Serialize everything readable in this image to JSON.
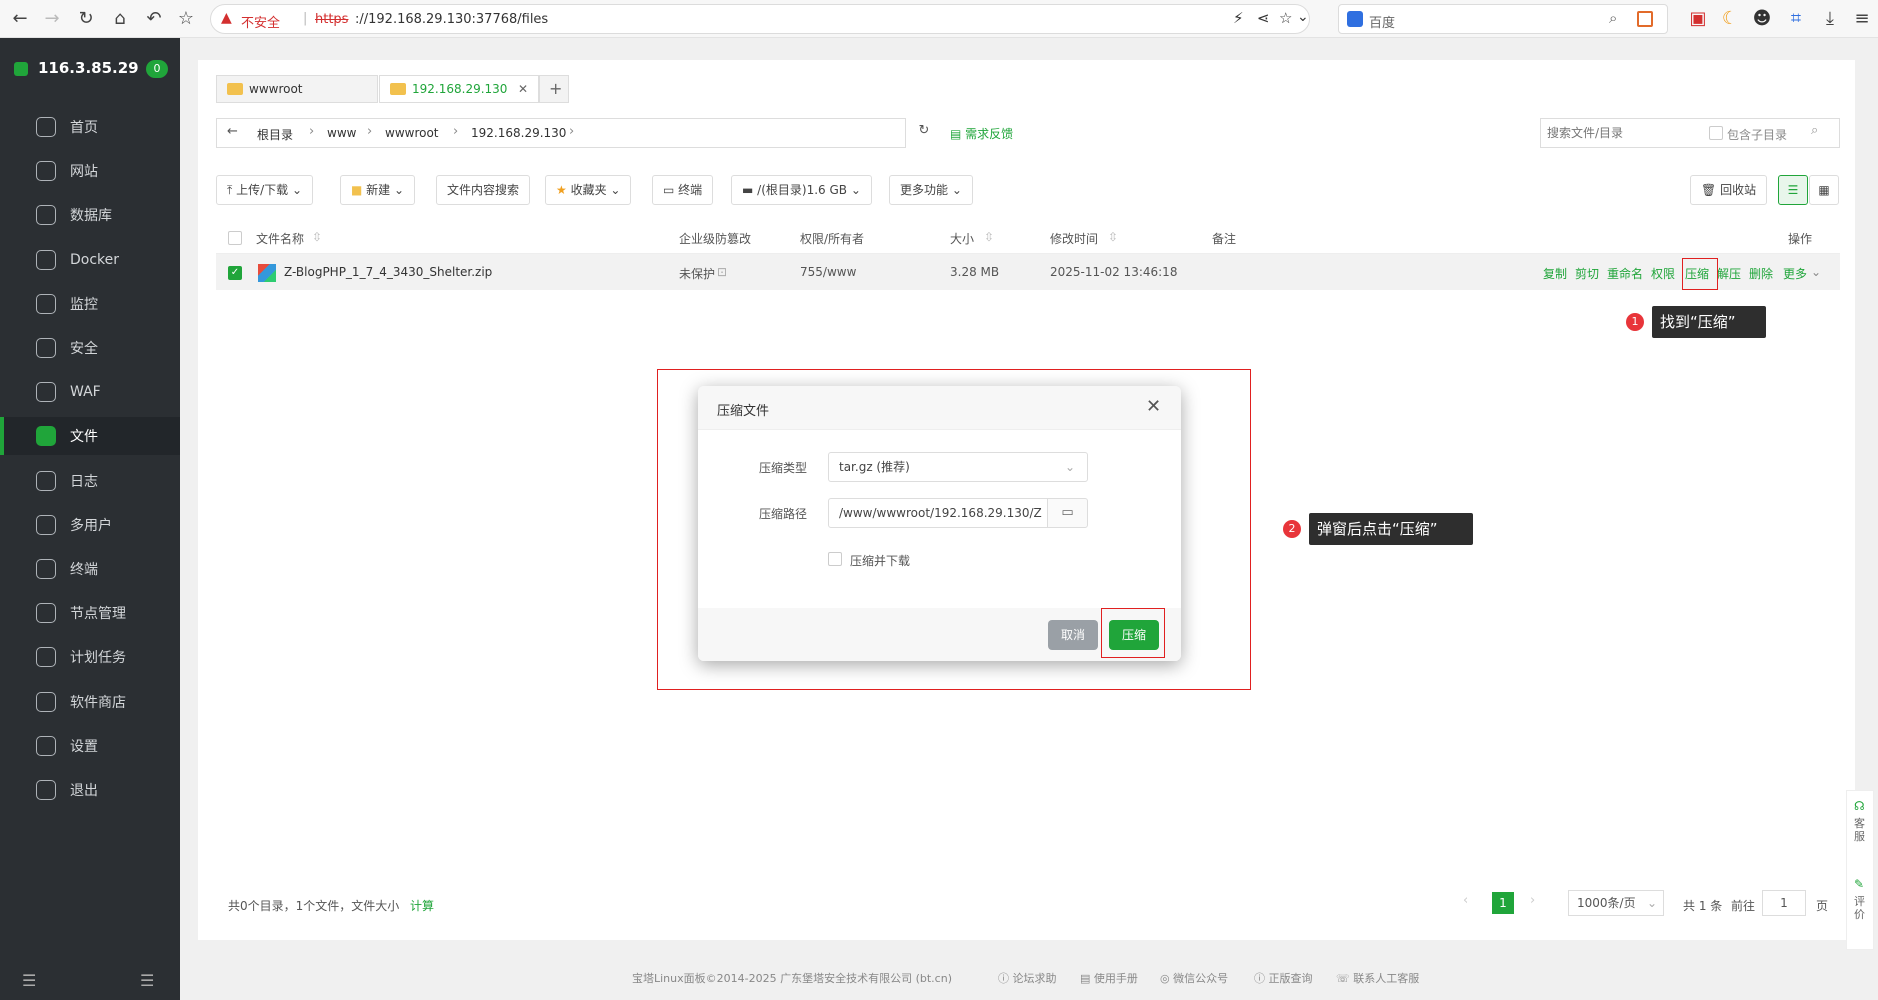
{
  "browser": {
    "not_secure": "不安全",
    "url_scheme": "https",
    "url_rest": "://192.168.29.130:37768/files",
    "search_engine": "百度"
  },
  "sidebar": {
    "host": "116.3.85.29",
    "count": "0",
    "items": [
      {
        "label": "首页",
        "icon": "home-icon"
      },
      {
        "label": "网站",
        "icon": "globe-icon"
      },
      {
        "label": "数据库",
        "icon": "database-icon"
      },
      {
        "label": "Docker",
        "icon": "docker-icon"
      },
      {
        "label": "监控",
        "icon": "monitor-icon"
      },
      {
        "label": "安全",
        "icon": "shield-icon"
      },
      {
        "label": "WAF",
        "icon": "waf-icon"
      },
      {
        "label": "文件",
        "icon": "folder-icon",
        "active": true
      },
      {
        "label": "日志",
        "icon": "log-icon"
      },
      {
        "label": "多用户",
        "icon": "users-icon"
      },
      {
        "label": "终端",
        "icon": "terminal-icon"
      },
      {
        "label": "节点管理",
        "icon": "node-icon"
      },
      {
        "label": "计划任务",
        "icon": "calendar-icon"
      },
      {
        "label": "软件商店",
        "icon": "store-icon"
      },
      {
        "label": "设置",
        "icon": "gear-icon"
      },
      {
        "label": "退出",
        "icon": "logout-icon"
      }
    ]
  },
  "tabs": [
    "wwwroot",
    "192.168.29.130"
  ],
  "breadcrumb": [
    "根目录",
    "www",
    "wwwroot",
    "192.168.29.130"
  ],
  "feedback": "需求反馈",
  "search": {
    "placeholder": "搜索文件/目录",
    "subdir": "包含子目录"
  },
  "toolbar": {
    "upload": "上传/下载",
    "new": "新建",
    "content_search": "文件内容搜索",
    "favorites": "收藏夹",
    "terminal": "终端",
    "disk": "/(根目录)1.6 GB",
    "more": "更多功能",
    "recycle": "回收站"
  },
  "table": {
    "headers": {
      "name": "文件名称",
      "protect": "企业级防篡改",
      "perm": "权限/所有者",
      "size": "大小",
      "mtime": "修改时间",
      "note": "备注",
      "ops": "操作"
    },
    "row": {
      "name": "Z-BlogPHP_1_7_4_3430_Shelter.zip",
      "protect": "未保护",
      "perm": "755/www",
      "size": "3.28 MB",
      "mtime": "2025-11-02 13:46:18",
      "ops": [
        "复制",
        "剪切",
        "重命名",
        "权限",
        "压缩",
        "解压",
        "删除",
        "更多"
      ]
    }
  },
  "footer_info": {
    "summary": "共0个目录，1个文件，文件大小",
    "calc": "计算"
  },
  "pagination": {
    "page": "1",
    "per_page": "1000条/页",
    "total": "共 1 条",
    "goto": "前往",
    "goto_val": "1",
    "page_unit": "页"
  },
  "copyright": "宝塔Linux面板©2014-2025 广东堡塔安全技术有限公司 (bt.cn)",
  "footer_links": [
    "论坛求助",
    "使用手册",
    "微信公众号",
    "正版查询",
    "联系人工客服"
  ],
  "float_tools": [
    "客服",
    "评价"
  ],
  "dialog": {
    "title": "压缩文件",
    "type_label": "压缩类型",
    "type_value": "tar.gz (推荐)",
    "path_label": "压缩路径",
    "path_value": "/www/wwwroot/192.168.29.130/Z",
    "download_label": "压缩并下载",
    "cancel": "取消",
    "confirm": "压缩"
  },
  "annotations": [
    {
      "num": "1",
      "text": "找到“压缩”"
    },
    {
      "num": "2",
      "text": "弹窗后点击“压缩”"
    }
  ]
}
